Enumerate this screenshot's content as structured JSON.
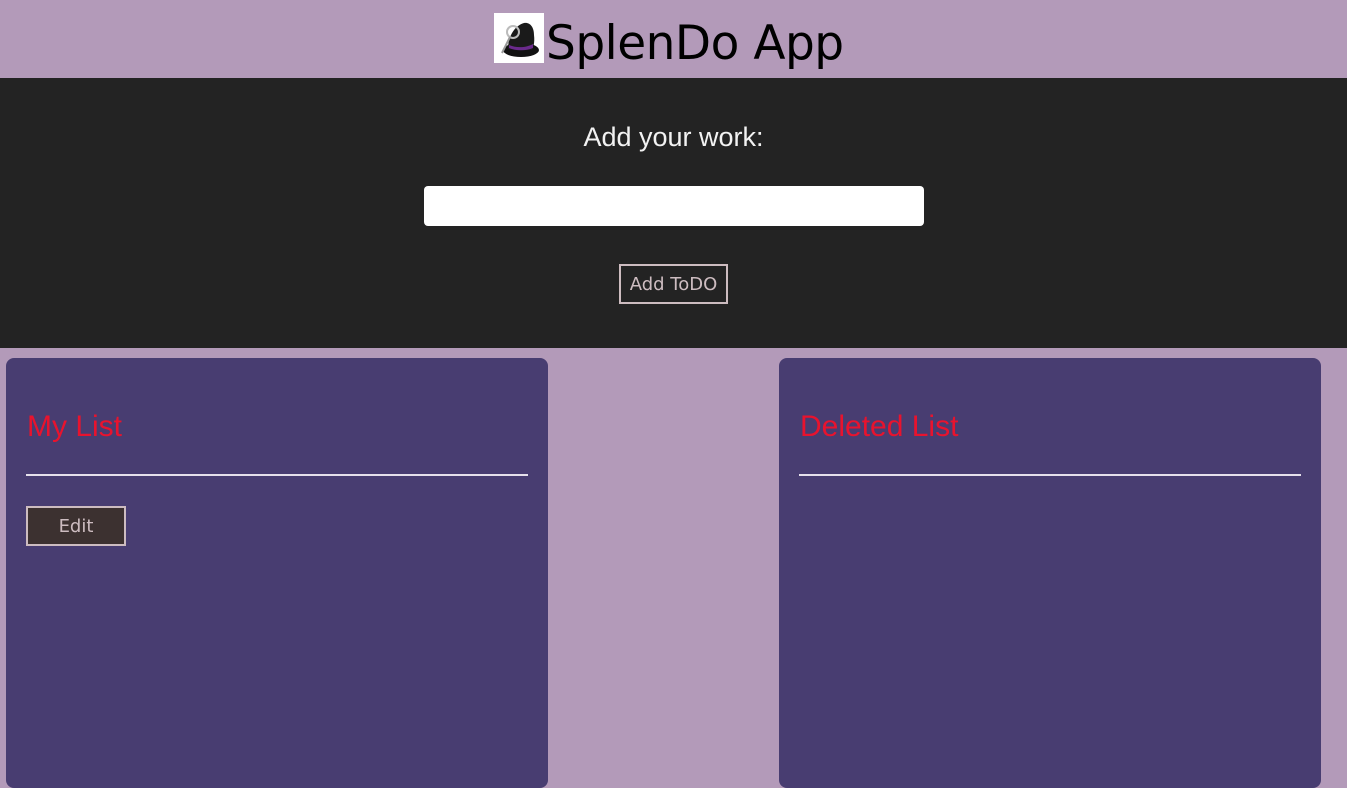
{
  "header": {
    "title": "SplenDo App",
    "logo_icon": "witch-hat-logo-icon"
  },
  "form": {
    "label": "Add your work:",
    "input_value": "",
    "input_placeholder": "",
    "add_button_label": "Add ToDO"
  },
  "my_list": {
    "title": "My List",
    "edit_button_label": "Edit",
    "items": []
  },
  "deleted_list": {
    "title": "Deleted List",
    "items": []
  },
  "colors": {
    "page_background": "#b39ab9",
    "form_background": "#232323",
    "panel_background": "#483d71",
    "panel_title": "#e8132e",
    "button_border": "#cdbcc0",
    "edit_button_background": "#3c3130"
  }
}
